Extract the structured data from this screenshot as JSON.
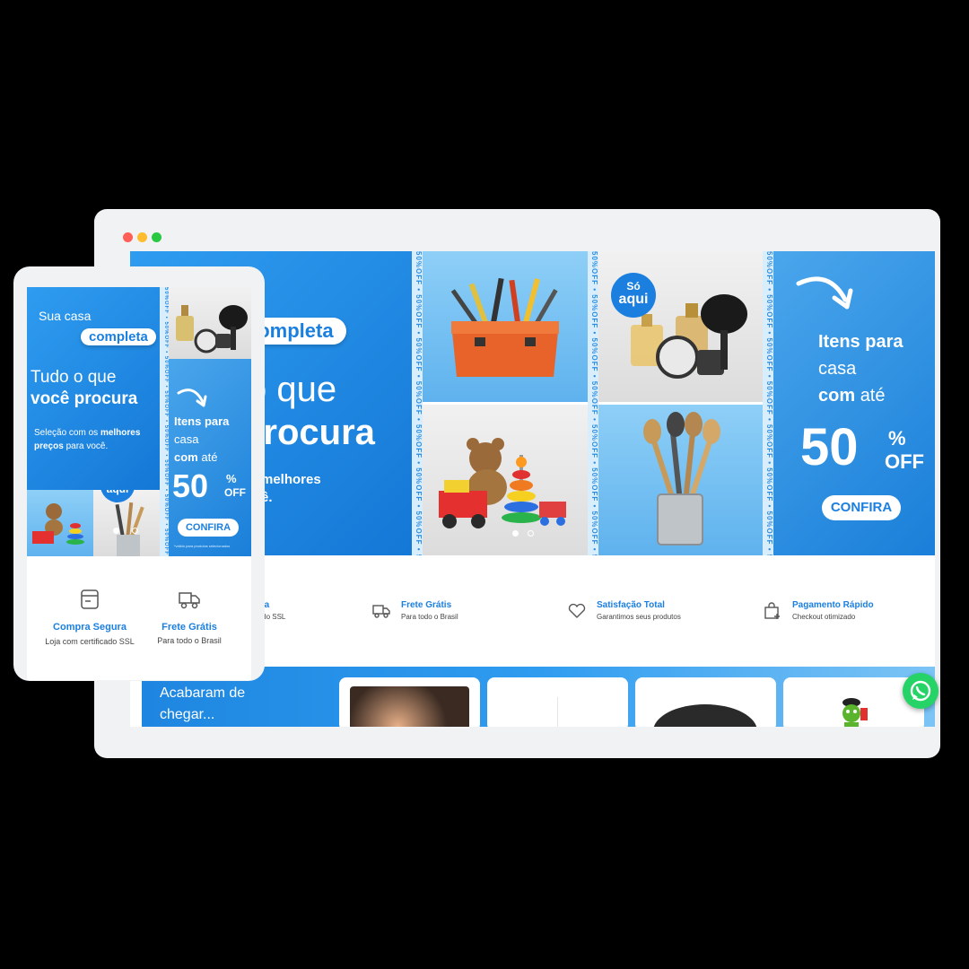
{
  "colors": {
    "brand_blue": "#1b7fe0",
    "hero_blue": "#2f9cf0",
    "window_red": "#ff5f57",
    "window_yellow": "#febc2e",
    "window_green": "#28c840",
    "whatsapp_green": "#25d366"
  },
  "window_controls": [
    "close-dot",
    "minimize-dot",
    "maximize-dot"
  ],
  "hero": {
    "brand_prefix": "Sua casa",
    "brand_pill": "completa",
    "headline_line1": "Tudo o que",
    "headline_line2": "você procura",
    "headline_line1_partial": "o que",
    "headline_line2_partial": "procura",
    "subtitle_prefix": "Seleção com os",
    "subtitle_bold1": "melhores",
    "subtitle_bold2": "preços",
    "subtitle_suffix": "para você.",
    "subtitle_partial_bold": "melhores",
    "subtitle_partial_end": "ê."
  },
  "stripe_text": "50%OFF • 50%OFF • 50%OFF • 50%OFF • 50%OFF • 50%OFF • 50%OFF • 50%OFF",
  "badge": {
    "line1": "Só",
    "line2": "aqui"
  },
  "promo": {
    "line1": "Itens para",
    "line2": "casa",
    "line3_prefix": "com",
    "line3_suffix": "até",
    "big_number": "50",
    "percent": "%",
    "off": "OFF",
    "cta": "CONFIRA",
    "disclaimer": "*válido para produtos selecionados"
  },
  "carousel": {
    "count": 2,
    "active": 0
  },
  "features": [
    {
      "icon": "card-icon",
      "title": "Compra Segura",
      "subtitle": "Loja com certificado SSL"
    },
    {
      "icon": "truck-icon",
      "title": "Frete Grátis",
      "subtitle": "Para todo o Brasil"
    },
    {
      "icon": "heart-icon",
      "title": "Satisfação Total",
      "subtitle": "Garantimos seus produtos"
    },
    {
      "icon": "bag-icon",
      "title": "Pagamento Rápido",
      "subtitle": "Checkout otimizado"
    }
  ],
  "features_desktop_partial": {
    "title": "egura",
    "subtitle": "rtificado SSL"
  },
  "arrivals": {
    "title_line1": "Acabaram de",
    "title_line2": "chegar..."
  }
}
